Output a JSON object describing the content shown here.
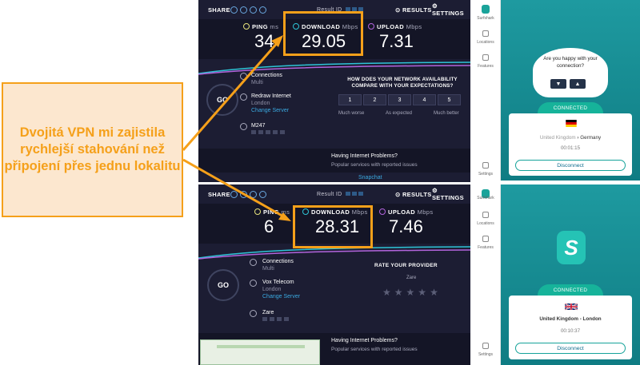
{
  "callout": {
    "text": "Dvojitá VPN mi zajistila rychlejší stahování než připojení přes jednu lokalitu"
  },
  "speedtest_top": {
    "share": "SHARE",
    "result_id": "Result ID",
    "results": "RESULTS",
    "settings": "SETTINGS",
    "ping_label": "PING",
    "ping_unit": "ms",
    "ping": "34",
    "download_label": "DOWNLOAD",
    "download_unit": "Mbps",
    "download": "29.05",
    "upload_label": "UPLOAD",
    "upload_unit": "Mbps",
    "upload": "7.31",
    "go": "GO",
    "connections": "Connections",
    "connections_mode": "Multi",
    "isp": "Redraw Internet",
    "isp_city": "London",
    "change_server": "Change Server",
    "host": "M247",
    "survey_title": "HOW DOES YOUR NETWORK AVAILABILITY COMPARE WITH YOUR EXPECTATIONS?",
    "scale": [
      "1",
      "2",
      "3",
      "4",
      "5"
    ],
    "scale_low": "Much worse",
    "scale_mid": "As expected",
    "scale_high": "Much better",
    "problems_title": "Having Internet Problems?",
    "problems_sub": "Popular services with reported issues",
    "service": "Snapchat"
  },
  "speedtest_bottom": {
    "share": "SHARE",
    "result_id": "Result ID",
    "results": "RESULTS",
    "settings": "SETTINGS",
    "ping_label": "PING",
    "ping_unit": "ms",
    "ping": "6",
    "download_label": "DOWNLOAD",
    "download_unit": "Mbps",
    "download": "28.31",
    "upload_label": "UPLOAD",
    "upload_unit": "Mbps",
    "upload": "7.46",
    "go": "GO",
    "connections": "Connections",
    "connections_mode": "Multi",
    "isp": "Vox Telecom",
    "isp_city": "London",
    "change_server": "Change Server",
    "host": "Zare",
    "rate_title": "RATE YOUR PROVIDER",
    "provider": "Zare",
    "problems_title": "Having Internet Problems?",
    "problems_sub": "Popular services with reported issues"
  },
  "surfshark_top": {
    "brand": "Surfshark",
    "nav": [
      "Locations",
      "Features",
      "Settings"
    ],
    "question": "Are you happy with your connection?",
    "status": "CONNECTED",
    "from": "United Kingdom",
    "to": "Germany",
    "time": "00:01:15",
    "disconnect": "Disconnect"
  },
  "surfshark_bottom": {
    "brand": "Surfshark",
    "nav": [
      "Locations",
      "Features",
      "Settings"
    ],
    "status": "CONNECTED",
    "location": "United Kingdom - London",
    "time": "00:10:37",
    "disconnect": "Disconnect"
  },
  "colors": {
    "accent": "#f5a01a",
    "speedtest_bg": "#1c1d33",
    "surfshark": "#16b39a"
  }
}
